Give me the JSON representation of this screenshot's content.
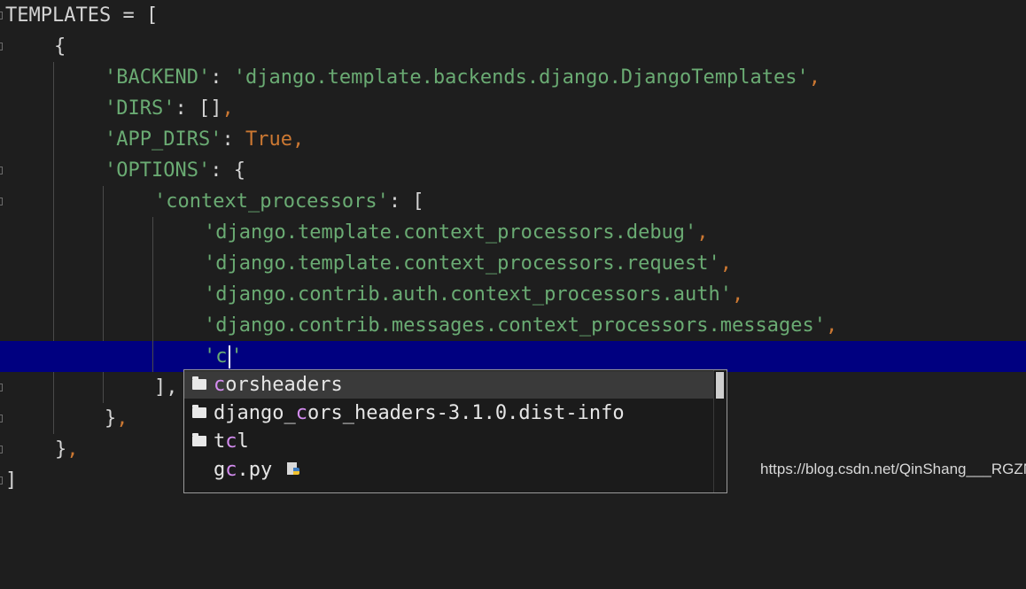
{
  "colors": {
    "background": "#1e1e1e",
    "string": "#6aab73",
    "keyword": "#cc7832",
    "current_line": "#000080",
    "match_highlight": "#d48cf0"
  },
  "code": {
    "line1": {
      "text": "TEMPLATES = ["
    },
    "line2": {
      "text": "{"
    },
    "line3": {
      "key": "'BACKEND'",
      "sep": ": ",
      "value": "'django.template.backends.django.DjangoTemplates'",
      "comma": ","
    },
    "line4": {
      "key": "'DIRS'",
      "sep": ": ",
      "value": "[]",
      "comma": ","
    },
    "line5": {
      "key": "'APP_DIRS'",
      "sep": ": ",
      "value": "True",
      "comma": ","
    },
    "line6": {
      "key": "'OPTIONS'",
      "sep": ": ",
      "value": "{"
    },
    "line7": {
      "key": "'context_processors'",
      "sep": ": ",
      "value": "["
    },
    "line8": {
      "value": "'django.template.context_processors.debug'",
      "comma": ","
    },
    "line9": {
      "value": "'django.template.context_processors.request'",
      "comma": ","
    },
    "line10": {
      "value": "'django.contrib.auth.context_processors.auth'",
      "comma": ","
    },
    "line11": {
      "value": "'django.contrib.messages.context_processors.messages'",
      "comma": ","
    },
    "line12": {
      "before": "'c",
      "after": "'"
    },
    "line13": {
      "text": "],",
      "comma": ""
    },
    "line14": {
      "text": "}",
      "comma": ","
    },
    "line15": {
      "text": "}",
      "comma": ","
    },
    "line16": {
      "text": "]"
    }
  },
  "autocomplete": {
    "items": [
      {
        "icon": "folder-icon",
        "match": "c",
        "rest": "orsheaders",
        "prefix": ""
      },
      {
        "icon": "folder-icon",
        "prefix": "django_",
        "match": "c",
        "rest": "ors_headers-3.1.0.dist-info"
      },
      {
        "icon": "folder-icon",
        "prefix": "t",
        "match": "c",
        "rest": "l"
      },
      {
        "icon": "python-file-icon",
        "prefix": "g",
        "match": "c",
        "rest": ".py"
      }
    ]
  },
  "watermark": "https://blog.csdn.net/QinShang___RGZN"
}
